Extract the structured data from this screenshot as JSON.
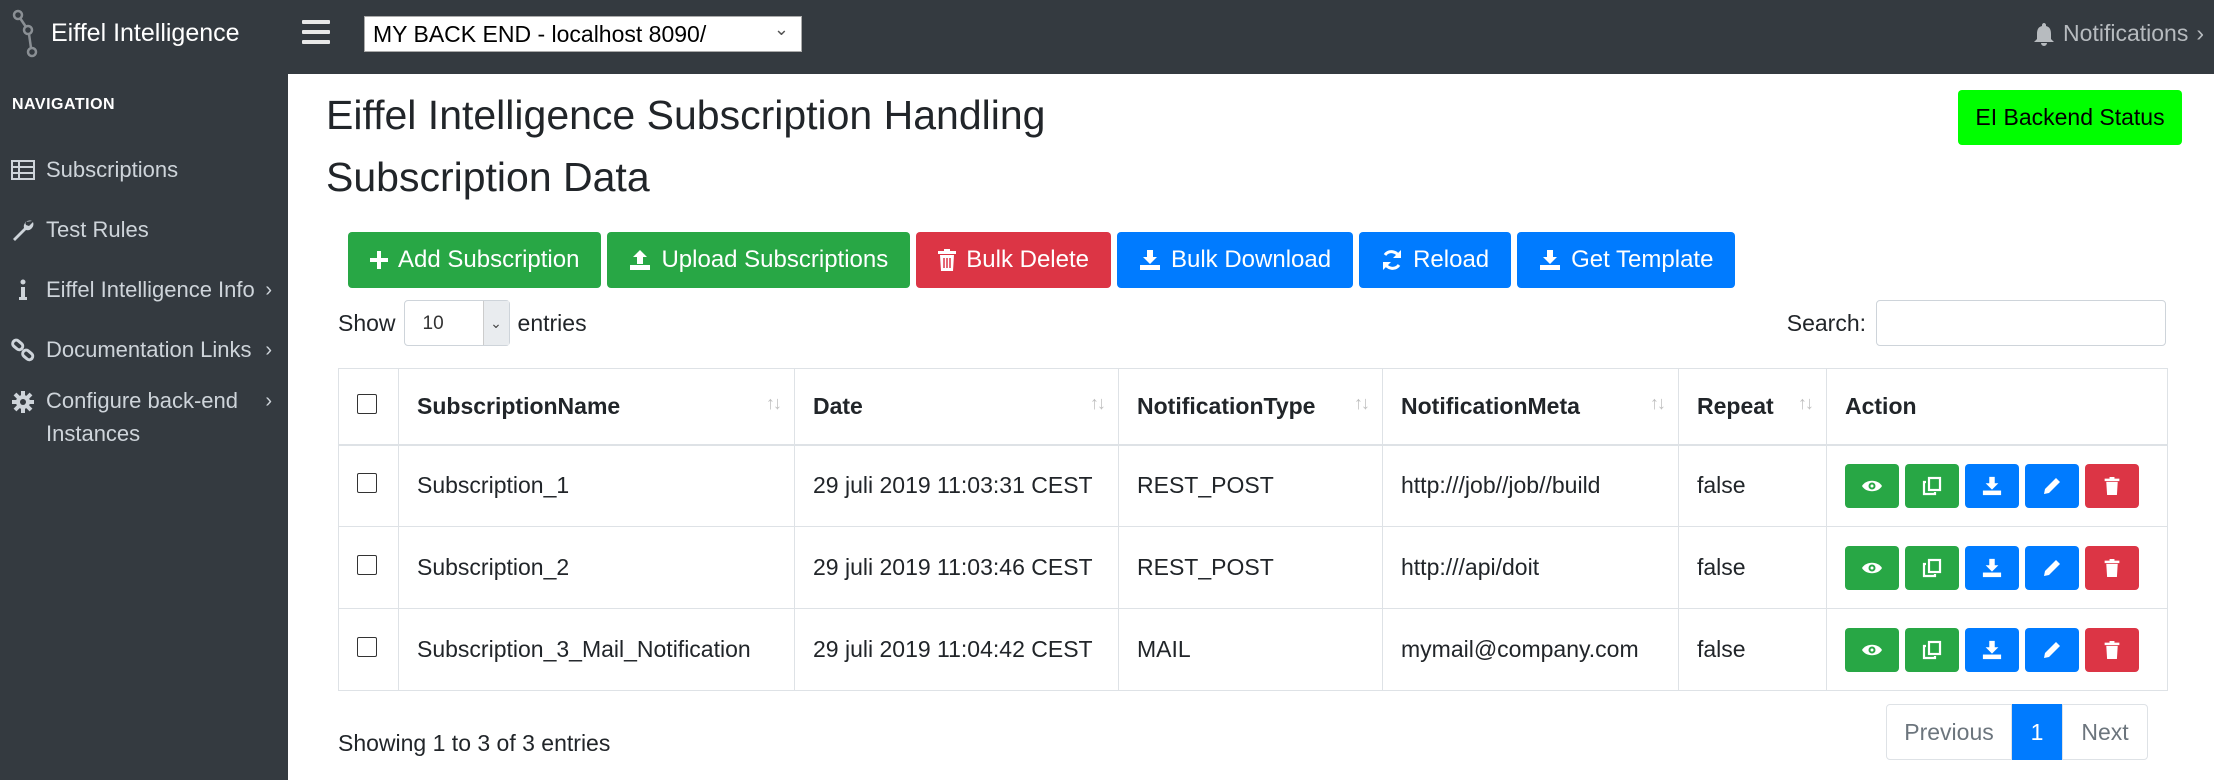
{
  "header": {
    "brand": "Eiffel Intelligence",
    "backend_select": "MY BACK END - localhost 8090/",
    "notifications": "Notifications"
  },
  "sidebar": {
    "heading": "NAVIGATION",
    "items": [
      {
        "label": "Subscriptions",
        "icon": "table-icon"
      },
      {
        "label": "Test Rules",
        "icon": "wrench-icon"
      },
      {
        "label": "Eiffel Intelligence Info",
        "icon": "info-icon"
      },
      {
        "label": "Documentation Links",
        "icon": "link-icon"
      },
      {
        "label": "Configure back-end",
        "label2": "Instances",
        "icon": "gear-icon"
      }
    ]
  },
  "main": {
    "title": "Eiffel Intelligence Subscription Handling",
    "subtitle": "Subscription Data",
    "status_button": "EI Backend Status",
    "status_color": "#00ff00",
    "buttons": {
      "add": "Add Subscription",
      "upload": "Upload Subscriptions",
      "bulk_delete": "Bulk Delete",
      "bulk_download": "Bulk Download",
      "reload": "Reload",
      "get_template": "Get Template"
    },
    "show_label": "Show",
    "entries_value": "10",
    "entries_label": "entries",
    "search_label": "Search:",
    "columns": [
      "SubscriptionName",
      "Date",
      "NotificationType",
      "NotificationMeta",
      "Repeat",
      "Action"
    ],
    "rows": [
      {
        "name": "Subscription_1",
        "date": "29 juli 2019 11:03:31 CEST",
        "type": "REST_POST",
        "meta": "http:///job//job//build",
        "repeat": "false"
      },
      {
        "name": "Subscription_2",
        "date": "29 juli 2019 11:03:46 CEST",
        "type": "REST_POST",
        "meta": "http:///api/doit",
        "repeat": "false"
      },
      {
        "name": "Subscription_3_Mail_Notification",
        "date": "29 juli 2019 11:04:42 CEST",
        "type": "MAIL",
        "meta": "mymail@company.com",
        "repeat": "false"
      }
    ],
    "info": "Showing 1 to 3 of 3 entries",
    "pager": {
      "previous": "Previous",
      "current": "1",
      "next": "Next"
    }
  },
  "colors": {
    "green": "#28a745",
    "red": "#dc3545",
    "blue": "#007bff",
    "dark": "#343a40"
  }
}
